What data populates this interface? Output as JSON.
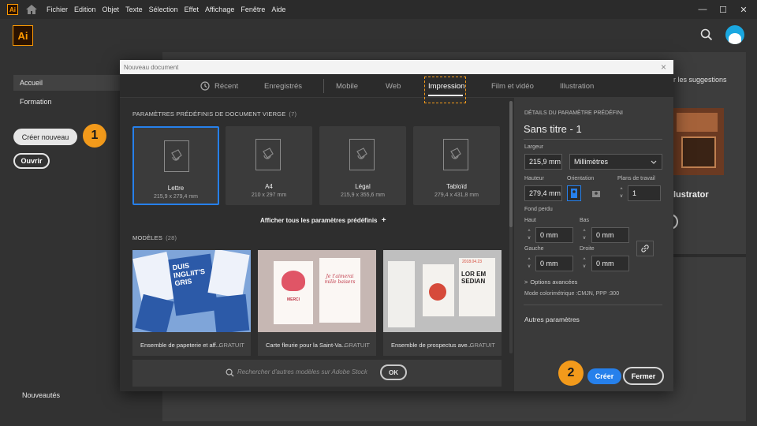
{
  "menubar": {
    "items": [
      "Fichier",
      "Edition",
      "Objet",
      "Texte",
      "Sélection",
      "Effet",
      "Affichage",
      "Fenêtre",
      "Aide"
    ],
    "app_logo": "Ai",
    "window_controls": [
      "—",
      "☐",
      "✕"
    ]
  },
  "header": {
    "logo": "Ai",
    "search_icon": "search-icon",
    "avatar_color": "#1aa7e0"
  },
  "sidebar": {
    "items": [
      "Accueil",
      "Formation"
    ],
    "create_button": "Créer nouveau",
    "open_button": "Ouvrir",
    "footer_item": "Nouveautés"
  },
  "background": {
    "suggestions_text": "r les suggestions",
    "card_title": "lustrator"
  },
  "badges": {
    "one": "1",
    "two": "2"
  },
  "dialog": {
    "title": "Nouveau document",
    "close": "×",
    "tabs": [
      "Récent",
      "Enregistrés",
      "Mobile",
      "Web",
      "Impression",
      "Film et vidéo",
      "Illustration"
    ],
    "active_tab": "Impression",
    "presets_header": "PARAMÈTRES PRÉDÉFINIS DE DOCUMENT VIERGE",
    "presets_count": "(7)",
    "presets": [
      {
        "name": "Lettre",
        "size": "215,9 x 279,4 mm"
      },
      {
        "name": "A4",
        "size": "210 x 297 mm"
      },
      {
        "name": "Légal",
        "size": "215,9 x 355,6 mm"
      },
      {
        "name": "Tabloïd",
        "size": "279,4 x 431,8 mm"
      }
    ],
    "show_all": "Afficher tous les paramètres prédéfinis",
    "show_all_plus": "+",
    "templates_header": "MODÈLES",
    "templates_count": "(28)",
    "templates": [
      {
        "name": "Ensemble de papeterie et aff...",
        "badge": "GRATUIT"
      },
      {
        "name": "Carte fleurie pour la Saint-Va...",
        "badge": "GRATUIT"
      },
      {
        "name": "Ensemble de prospectus ave...",
        "badge": "GRATUIT"
      }
    ],
    "thumb1": {
      "line1": "DUIS",
      "line2": "INGLIIT'S",
      "line3": "GRIS"
    },
    "thumb2": {
      "script": "Je t'aimerai mille baisers",
      "heart": "MERCI"
    },
    "thumb3": {
      "a": "LOR EM SEDIAN",
      "b": "2018.04.23"
    },
    "stock_search_placeholder": "Rechercher d'autres modèles sur Adobe Stock",
    "stock_ok": "OK",
    "details": {
      "header": "DÉTAILS DU PARAMÈTRE PRÉDÉFINI",
      "doc_name": "Sans titre - 1",
      "width_label": "Largeur",
      "width_value": "215,9 mm",
      "unit_value": "Millimètres",
      "height_label": "Hauteur",
      "height_value": "279,4 mm",
      "orientation_label": "Orientation",
      "artboards_label": "Plans de travail",
      "artboards_value": "1",
      "bleed_label": "Fond perdu",
      "top_label": "Haut",
      "top_value": "0 mm",
      "bottom_label": "Bas",
      "bottom_value": "0 mm",
      "left_label": "Gauche",
      "left_value": "0 mm",
      "right_label": "Droite",
      "right_value": "0 mm",
      "advanced": "Options avancées",
      "color_mode": "Mode colorimétrique :CMJN, PPP :300",
      "more_settings": "Autres paramètres",
      "create_button": "Créer",
      "close_button": "Fermer"
    }
  },
  "colors": {
    "accent": "#2680eb",
    "badge": "#f29a1b",
    "highlight": "#f29a1b"
  }
}
